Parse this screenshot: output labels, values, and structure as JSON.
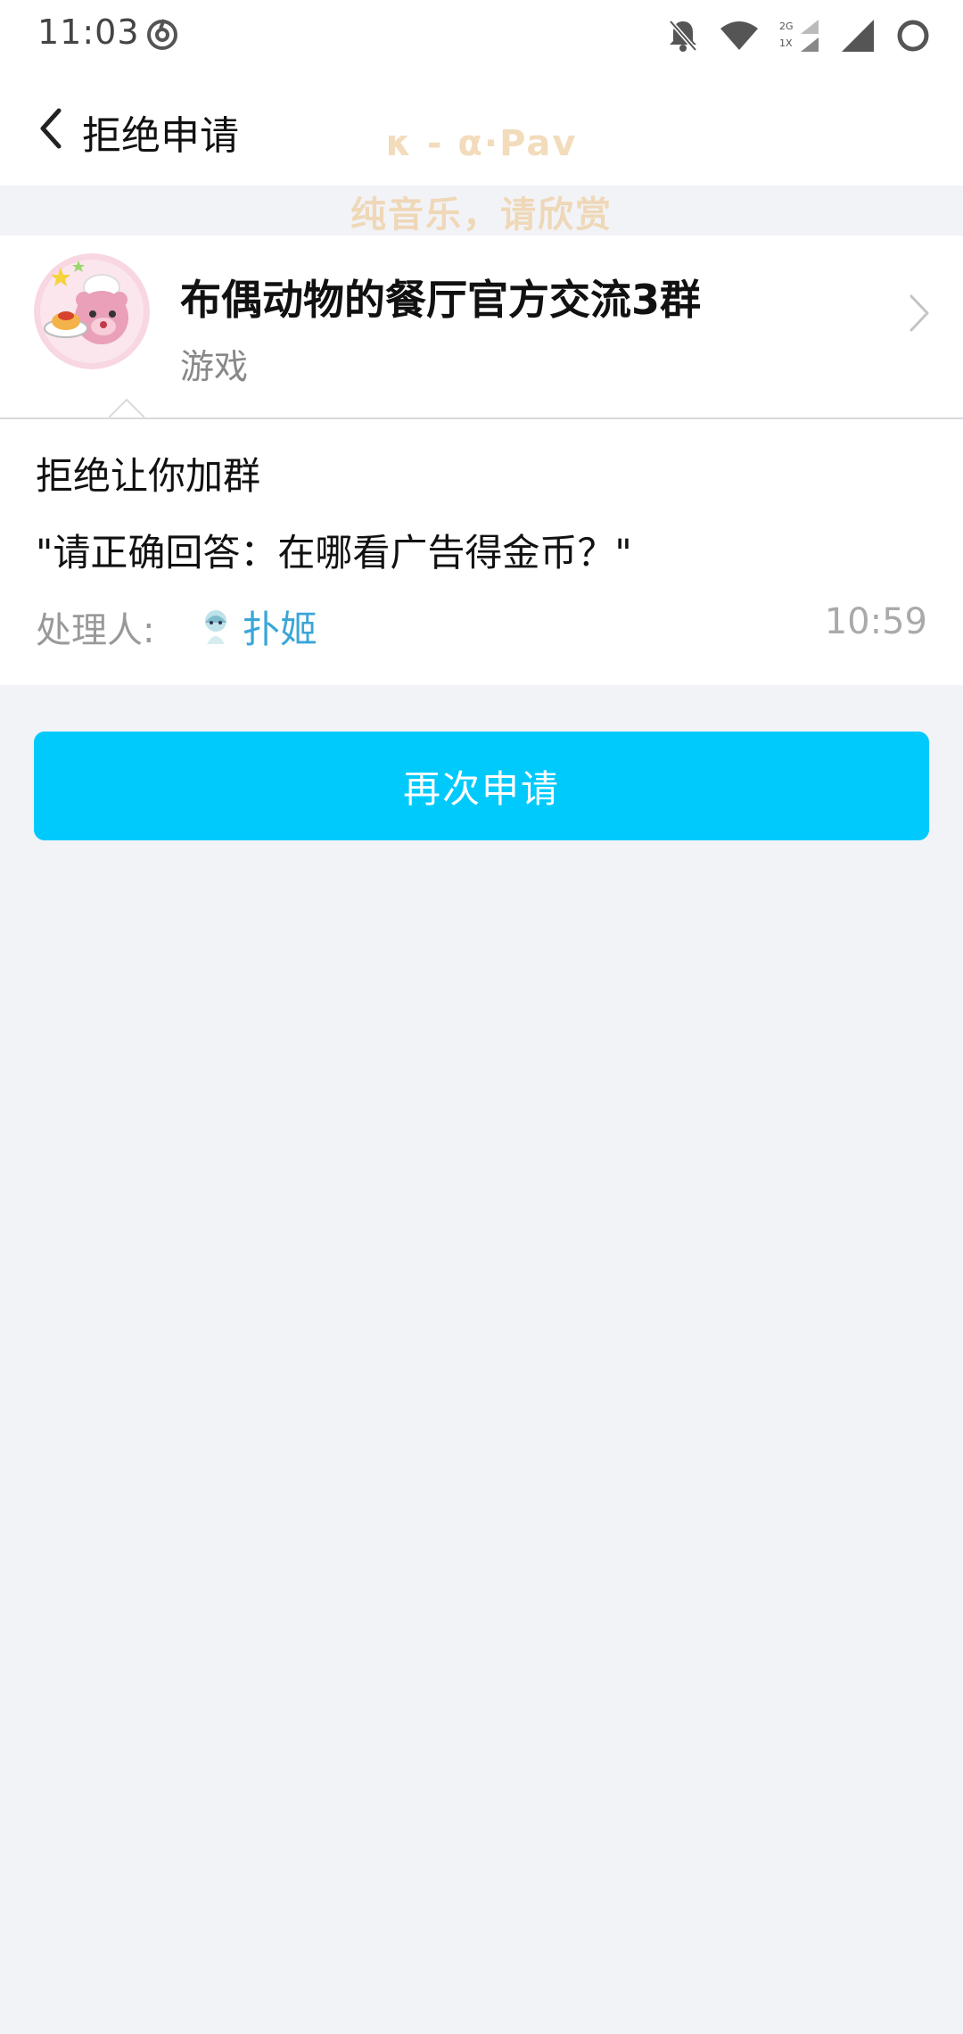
{
  "status_bar": {
    "time": "11:03",
    "app_icon": "netease-music-icon",
    "icons": [
      "bell-off-icon",
      "wifi-icon",
      "signal-2g-1x-icon",
      "signal-icon",
      "battery-ring-icon"
    ],
    "network_labels": [
      "2G",
      "1X"
    ]
  },
  "nav": {
    "back_icon": "chevron-left-icon",
    "title": "拒绝申请"
  },
  "overlay": {
    "line1": "κ - α·Pav",
    "line2": "纯音乐，请欣赏"
  },
  "group": {
    "name": "布偶动物的餐厅官方交流3群",
    "category": "游戏",
    "avatar": "group-avatar-bear-chef"
  },
  "detail": {
    "title": "拒绝让你加群",
    "reason": "\"请正确回答：在哪看广告得金币？\"",
    "handler_label": "处理人:",
    "handler_name": "扑姬",
    "time": "10:59"
  },
  "actions": {
    "reapply_label": "再次申请"
  },
  "colors": {
    "accent": "#00cafc",
    "link": "#3aa6d8",
    "background": "#f2f3f7"
  }
}
